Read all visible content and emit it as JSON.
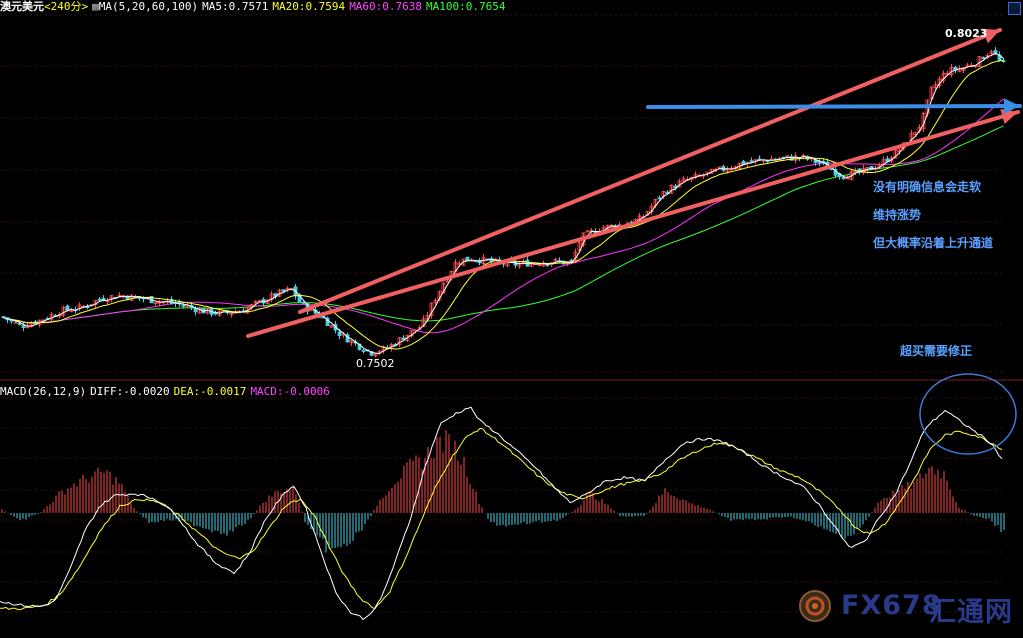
{
  "header": {
    "symbol": "澳元美元",
    "period": "<240分>",
    "ma_params": "MA(5,20,60,100)",
    "ma5": "MA5:0.7571",
    "ma20": "MA20:0.7594",
    "ma60": "MA60:0.7638",
    "ma100": "MA100:0.7654"
  },
  "macd_header": {
    "params": "MACD(26,12,9)",
    "diff": "DIFF:-0.0020",
    "dea": "DEA:-0.0017",
    "macd": "MACD:-0.0006"
  },
  "annotations": {
    "high": "0.8023",
    "low": "0.7502",
    "note1": "没有明确信息会走软",
    "note2": "维持涨势",
    "note3": "但大概率沿着上升通道",
    "note4": "超买需要修正"
  },
  "watermark": {
    "brand": "FX678",
    "cn": "汇通网"
  },
  "colors": {
    "bg": "#000000",
    "up": "#ff4a4a",
    "down": "#46d2e6",
    "ma5": "#ffffff",
    "ma20": "#ffff33",
    "ma60": "#ff33ff",
    "ma100": "#33ff33",
    "channel": "#f06060",
    "horizontal_arrow": "#3c8de8",
    "diff": "#ffffff",
    "dea": "#ffff33",
    "annotation": "#5aa0ff"
  },
  "chart_data": {
    "type": "candlestick+macd",
    "price_ylim": [
      0.747,
      0.805
    ],
    "price_path": [
      [
        0,
        0.756
      ],
      [
        20,
        0.7545
      ],
      [
        40,
        0.7555
      ],
      [
        60,
        0.757
      ],
      [
        80,
        0.7575
      ],
      [
        100,
        0.759
      ],
      [
        120,
        0.7595
      ],
      [
        140,
        0.759
      ],
      [
        160,
        0.7585
      ],
      [
        180,
        0.758
      ],
      [
        200,
        0.757
      ],
      [
        220,
        0.7565
      ],
      [
        240,
        0.757
      ],
      [
        260,
        0.7585
      ],
      [
        280,
        0.76
      ],
      [
        290,
        0.7605
      ],
      [
        300,
        0.758
      ],
      [
        320,
        0.756
      ],
      [
        340,
        0.753
      ],
      [
        360,
        0.751
      ],
      [
        370,
        0.7502
      ],
      [
        385,
        0.7508
      ],
      [
        400,
        0.7525
      ],
      [
        420,
        0.7545
      ],
      [
        440,
        0.761
      ],
      [
        455,
        0.765
      ],
      [
        470,
        0.7655
      ],
      [
        490,
        0.765
      ],
      [
        510,
        0.7645
      ],
      [
        530,
        0.7648
      ],
      [
        550,
        0.765
      ],
      [
        570,
        0.7648
      ],
      [
        580,
        0.769
      ],
      [
        600,
        0.7705
      ],
      [
        620,
        0.771
      ],
      [
        640,
        0.772
      ],
      [
        660,
        0.776
      ],
      [
        680,
        0.778
      ],
      [
        700,
        0.779
      ],
      [
        720,
        0.78
      ],
      [
        740,
        0.781
      ],
      [
        760,
        0.7815
      ],
      [
        780,
        0.7818
      ],
      [
        800,
        0.782
      ],
      [
        820,
        0.781
      ],
      [
        840,
        0.779
      ],
      [
        860,
        0.7795
      ],
      [
        880,
        0.781
      ],
      [
        900,
        0.7835
      ],
      [
        920,
        0.7875
      ],
      [
        930,
        0.793
      ],
      [
        945,
        0.796
      ],
      [
        960,
        0.7965
      ],
      [
        975,
        0.7975
      ],
      [
        990,
        0.7995
      ],
      [
        1000,
        0.7972
      ]
    ],
    "macd_ylim": [
      -0.0065,
      0.0065
    ],
    "macd_hist_path": [
      [
        0,
        0.0003
      ],
      [
        20,
        -0.0005
      ],
      [
        40,
        0.0
      ],
      [
        60,
        0.0012
      ],
      [
        75,
        0.0018
      ],
      [
        90,
        0.0022
      ],
      [
        105,
        0.0025
      ],
      [
        120,
        0.0018
      ],
      [
        135,
        0.0002
      ],
      [
        150,
        -0.0006
      ],
      [
        170,
        -0.0004
      ],
      [
        190,
        -0.0006
      ],
      [
        210,
        -0.001
      ],
      [
        230,
        -0.0012
      ],
      [
        250,
        -0.0004
      ],
      [
        265,
        0.0008
      ],
      [
        280,
        0.0014
      ],
      [
        295,
        0.0015
      ],
      [
        305,
        -0.0005
      ],
      [
        320,
        -0.0018
      ],
      [
        335,
        -0.0024
      ],
      [
        350,
        -0.0018
      ],
      [
        365,
        -0.0008
      ],
      [
        380,
        0.0008
      ],
      [
        395,
        0.002
      ],
      [
        410,
        0.0028
      ],
      [
        425,
        0.0034
      ],
      [
        440,
        0.0044
      ],
      [
        452,
        0.0042
      ],
      [
        465,
        0.003
      ],
      [
        478,
        0.0008
      ],
      [
        490,
        -0.0006
      ],
      [
        510,
        -0.0008
      ],
      [
        530,
        -0.0006
      ],
      [
        560,
        -0.0004
      ],
      [
        575,
        0.0002
      ],
      [
        590,
        0.0012
      ],
      [
        605,
        0.0006
      ],
      [
        620,
        -0.0002
      ],
      [
        645,
        -0.0002
      ],
      [
        665,
        0.0014
      ],
      [
        690,
        0.0006
      ],
      [
        710,
        0.0002
      ],
      [
        730,
        -0.0004
      ],
      [
        760,
        -0.0004
      ],
      [
        790,
        -0.0002
      ],
      [
        810,
        -0.0006
      ],
      [
        830,
        -0.0012
      ],
      [
        850,
        -0.0014
      ],
      [
        865,
        -0.0006
      ],
      [
        880,
        0.0008
      ],
      [
        900,
        0.0014
      ],
      [
        915,
        0.0018
      ],
      [
        930,
        0.0028
      ],
      [
        945,
        0.0024
      ],
      [
        958,
        0.0004
      ],
      [
        975,
        -0.0002
      ],
      [
        990,
        -0.0004
      ],
      [
        1003,
        -0.0012
      ]
    ],
    "macd_diff_path": [
      [
        0,
        -0.005
      ],
      [
        20,
        -0.0052
      ],
      [
        40,
        -0.0053
      ],
      [
        55,
        -0.005
      ],
      [
        70,
        -0.0032
      ],
      [
        85,
        -0.001
      ],
      [
        100,
        0.0004
      ],
      [
        115,
        0.001
      ],
      [
        135,
        0.0011
      ],
      [
        155,
        0.0008
      ],
      [
        175,
        0.0
      ],
      [
        195,
        -0.0016
      ],
      [
        215,
        -0.0028
      ],
      [
        235,
        -0.0034
      ],
      [
        250,
        -0.0022
      ],
      [
        265,
        -0.0004
      ],
      [
        280,
        0.0008
      ],
      [
        293,
        0.0016
      ],
      [
        305,
        0.0004
      ],
      [
        320,
        -0.002
      ],
      [
        335,
        -0.0044
      ],
      [
        350,
        -0.0056
      ],
      [
        365,
        -0.006
      ],
      [
        380,
        -0.005
      ],
      [
        395,
        -0.0028
      ],
      [
        410,
        -0.0004
      ],
      [
        425,
        0.0026
      ],
      [
        440,
        0.005
      ],
      [
        455,
        0.0056
      ],
      [
        470,
        0.006
      ],
      [
        480,
        0.0052
      ],
      [
        495,
        0.0046
      ],
      [
        515,
        0.0036
      ],
      [
        535,
        0.0026
      ],
      [
        555,
        0.0014
      ],
      [
        570,
        0.0006
      ],
      [
        585,
        0.001
      ],
      [
        605,
        0.0018
      ],
      [
        625,
        0.002
      ],
      [
        645,
        0.0018
      ],
      [
        665,
        0.003
      ],
      [
        685,
        0.004
      ],
      [
        705,
        0.0042
      ],
      [
        725,
        0.004
      ],
      [
        745,
        0.0034
      ],
      [
        765,
        0.0026
      ],
      [
        785,
        0.002
      ],
      [
        805,
        0.0014
      ],
      [
        820,
        0.0004
      ],
      [
        835,
        -0.0008
      ],
      [
        850,
        -0.002
      ],
      [
        865,
        -0.0016
      ],
      [
        880,
        -0.0002
      ],
      [
        895,
        0.001
      ],
      [
        910,
        0.0028
      ],
      [
        925,
        0.0048
      ],
      [
        945,
        0.0058
      ],
      [
        960,
        0.0052
      ],
      [
        975,
        0.0046
      ],
      [
        990,
        0.004
      ],
      [
        1003,
        0.003
      ]
    ],
    "macd_dea_path": [
      [
        0,
        -0.0054
      ],
      [
        25,
        -0.0054
      ],
      [
        45,
        -0.0052
      ],
      [
        60,
        -0.0046
      ],
      [
        80,
        -0.003
      ],
      [
        100,
        -0.001
      ],
      [
        120,
        0.0004
      ],
      [
        140,
        0.0008
      ],
      [
        160,
        0.0006
      ],
      [
        180,
        -0.0002
      ],
      [
        200,
        -0.0012
      ],
      [
        220,
        -0.0022
      ],
      [
        240,
        -0.0026
      ],
      [
        255,
        -0.002
      ],
      [
        270,
        -0.0008
      ],
      [
        285,
        0.0004
      ],
      [
        300,
        0.0008
      ],
      [
        315,
        -0.0002
      ],
      [
        330,
        -0.002
      ],
      [
        345,
        -0.0036
      ],
      [
        360,
        -0.0048
      ],
      [
        375,
        -0.0054
      ],
      [
        390,
        -0.0044
      ],
      [
        405,
        -0.0026
      ],
      [
        420,
        -0.0006
      ],
      [
        435,
        0.0014
      ],
      [
        450,
        0.003
      ],
      [
        465,
        0.0042
      ],
      [
        480,
        0.0048
      ],
      [
        500,
        0.004
      ],
      [
        520,
        0.003
      ],
      [
        540,
        0.002
      ],
      [
        560,
        0.0012
      ],
      [
        580,
        0.0008
      ],
      [
        600,
        0.0012
      ],
      [
        620,
        0.0016
      ],
      [
        640,
        0.0018
      ],
      [
        660,
        0.0022
      ],
      [
        680,
        0.003
      ],
      [
        700,
        0.0036
      ],
      [
        720,
        0.004
      ],
      [
        740,
        0.0036
      ],
      [
        760,
        0.003
      ],
      [
        780,
        0.0024
      ],
      [
        800,
        0.002
      ],
      [
        820,
        0.0012
      ],
      [
        840,
        0.0002
      ],
      [
        855,
        -0.0008
      ],
      [
        870,
        -0.0012
      ],
      [
        885,
        -0.0006
      ],
      [
        900,
        0.0006
      ],
      [
        915,
        0.002
      ],
      [
        930,
        0.0036
      ],
      [
        945,
        0.0044
      ],
      [
        960,
        0.0046
      ],
      [
        975,
        0.0044
      ],
      [
        990,
        0.004
      ],
      [
        1003,
        0.0036
      ]
    ]
  }
}
